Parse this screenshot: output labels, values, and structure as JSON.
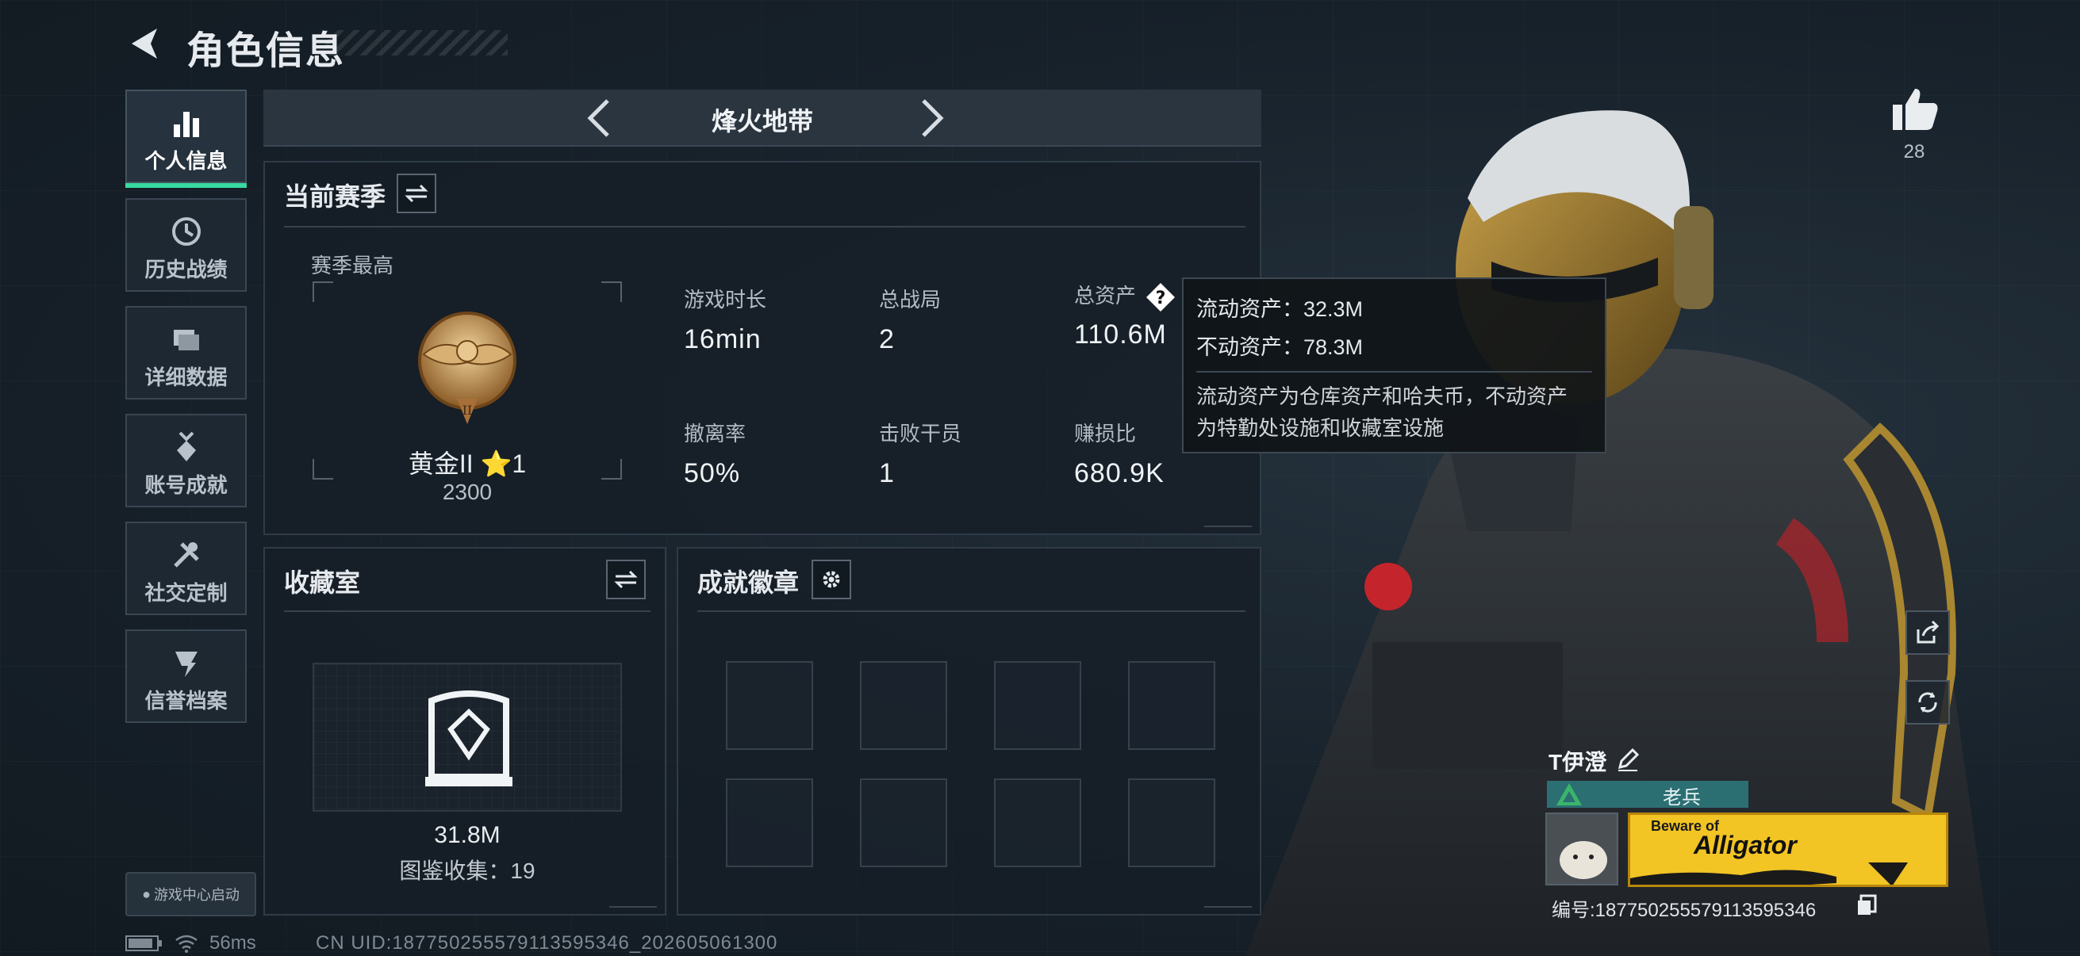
{
  "header": {
    "title": "角色信息"
  },
  "sidebar": {
    "items": [
      {
        "label": "个人信息",
        "icon": "bar-chart-icon"
      },
      {
        "label": "历史战绩",
        "icon": "history-clock-icon"
      },
      {
        "label": "详细数据",
        "icon": "folder-stack-icon"
      },
      {
        "label": "账号成就",
        "icon": "medal-icon"
      },
      {
        "label": "社交定制",
        "icon": "wrench-icon"
      },
      {
        "label": "信誉档案",
        "icon": "credit-shield-icon"
      }
    ],
    "game_center_label": "游戏中心启动"
  },
  "mode": {
    "title": "烽火地带"
  },
  "season": {
    "title": "当前赛季",
    "best_label": "赛季最高",
    "rank_name": "黄金II ⭐1",
    "rank_points": "2300",
    "stats": [
      {
        "key": "游戏时长",
        "value": "16min"
      },
      {
        "key": "总战局",
        "value": "2"
      },
      {
        "key": "总资产",
        "value": "110.6M"
      },
      {
        "key": "撤离率",
        "value": "50%"
      },
      {
        "key": "击败干员",
        "value": "1"
      },
      {
        "key": "赚损比",
        "value": "680.9K"
      }
    ]
  },
  "tooltip": {
    "liquid": "流动资产：32.3M",
    "fixed": "不动资产：78.3M",
    "note_line1": "流动资产为仓库资产和哈夫币，不动资产",
    "note_line2": "为特勤处设施和收藏室设施"
  },
  "collection": {
    "title": "收藏室",
    "value": "31.8M",
    "count": "图鉴收集：19"
  },
  "achievements": {
    "title": "成就徽章",
    "slot_count": 8
  },
  "footer": {
    "ping": "56ms",
    "uid": "CN UID:18775025557911359534​6_202605061300"
  },
  "likes": {
    "count": "28"
  },
  "player": {
    "name": "T伊澄",
    "rank_title": "老兵",
    "banner_line1": "Beware of",
    "banner_line2": "Alligator",
    "id_text": "编号:18775025557911359534​6"
  },
  "colors": {
    "accent": "#38d9a0",
    "rank_bar": "#2b6f73",
    "banner": "#f2c424"
  }
}
